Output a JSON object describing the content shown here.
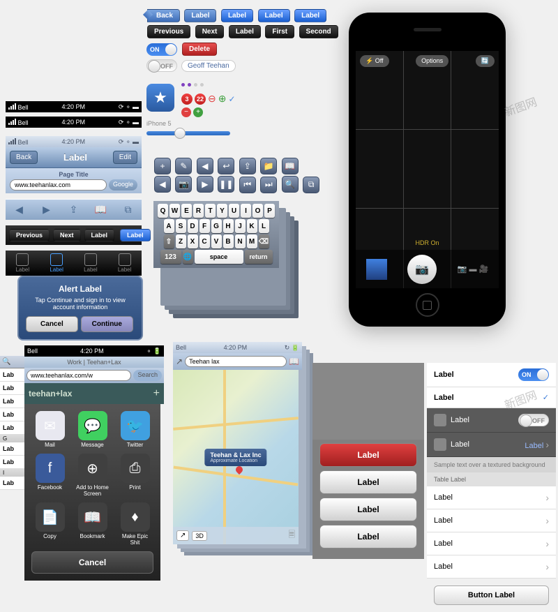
{
  "top_buttons": {
    "r1": [
      "Back",
      "Label",
      "Label",
      "Label",
      "Label"
    ],
    "r2": [
      "Previous",
      "Next",
      "Label",
      "First",
      "Second"
    ],
    "toggle_on": "ON",
    "toggle_off": "OFF",
    "delete": "Delete",
    "name_field": "Geoff Teehan",
    "iphone5": "iPhone 5",
    "badges": [
      "3",
      "22"
    ]
  },
  "status": {
    "carrier": "Bell",
    "time": "4:20 PM"
  },
  "nav": {
    "back": "Back",
    "title": "Label",
    "edit": "Edit",
    "page_title": "Page Title",
    "url": "www.teehanlax.com",
    "google": "Google",
    "seg": [
      "Previous",
      "Next",
      "Label",
      "Label"
    ]
  },
  "tabbar": {
    "items": [
      "Label",
      "Label",
      "Label",
      "Label"
    ]
  },
  "alert": {
    "title": "Alert Label",
    "text": "Tap Continue and sign in to view account information",
    "cancel": "Cancel",
    "continue": "Continue"
  },
  "keyboard": {
    "r1": [
      "Q",
      "W",
      "E",
      "R",
      "T",
      "Y",
      "U",
      "I",
      "O",
      "P"
    ],
    "r2": [
      "A",
      "S",
      "D",
      "F",
      "G",
      "H",
      "J",
      "K",
      "L"
    ],
    "r3": [
      "Z",
      "X",
      "C",
      "V",
      "B",
      "N",
      "M"
    ],
    "shift": "⇧",
    "del": "⌫",
    "num": "123",
    "space": "space",
    "return": "return"
  },
  "camera": {
    "flash": "Off",
    "options": "Options",
    "hdr": "HDR On"
  },
  "share": {
    "work": "Work | Teehan+Lax",
    "url": "www.teehanlax.com/w",
    "search": "Search",
    "brand": "teehan+lax",
    "items": [
      {
        "label": "Mail",
        "bg": "#e8e8f0",
        "icon": "✉"
      },
      {
        "label": "Message",
        "bg": "#40d060",
        "icon": "💬"
      },
      {
        "label": "Twitter",
        "bg": "#40a0e0",
        "icon": "🐦"
      },
      {
        "label": "Facebook",
        "bg": "#3a5a9a",
        "icon": "f"
      },
      {
        "label": "Add to Home Screen",
        "bg": "#404040",
        "icon": "⊕"
      },
      {
        "label": "Print",
        "bg": "#404040",
        "icon": "⎙"
      },
      {
        "label": "Copy",
        "bg": "#404040",
        "icon": "📄"
      },
      {
        "label": "Bookmark",
        "bg": "#404040",
        "icon": "📖"
      },
      {
        "label": "Make Epic Shit",
        "bg": "#404040",
        "icon": "♦"
      }
    ],
    "cancel": "Cancel"
  },
  "map": {
    "search": "Teehan lax",
    "callout_title": "Teehan & Lax Inc",
    "callout_sub": "Approximate Location",
    "btn_3d": "3D"
  },
  "action": {
    "labels": [
      "Label",
      "Label",
      "Label",
      "Label"
    ]
  },
  "table": {
    "toggles": [
      {
        "label": "Label",
        "on": true
      },
      {
        "label": "Label",
        "check": true
      }
    ],
    "dark": [
      {
        "label": "Label",
        "off": "OFF"
      },
      {
        "label": "Label",
        "val": "Label"
      }
    ],
    "sample": "Sample text over a textured background",
    "header": "Table Label",
    "rows": [
      "Label",
      "Label",
      "Label",
      "Label"
    ],
    "button": "Button Label"
  },
  "sidebar": {
    "items": [
      "Lab",
      "Lab",
      "Lab",
      "Lab",
      "Lab",
      "Lab",
      "Lab",
      "Lab"
    ],
    "headers": [
      "G",
      "I"
    ]
  },
  "watermark": "新图网"
}
